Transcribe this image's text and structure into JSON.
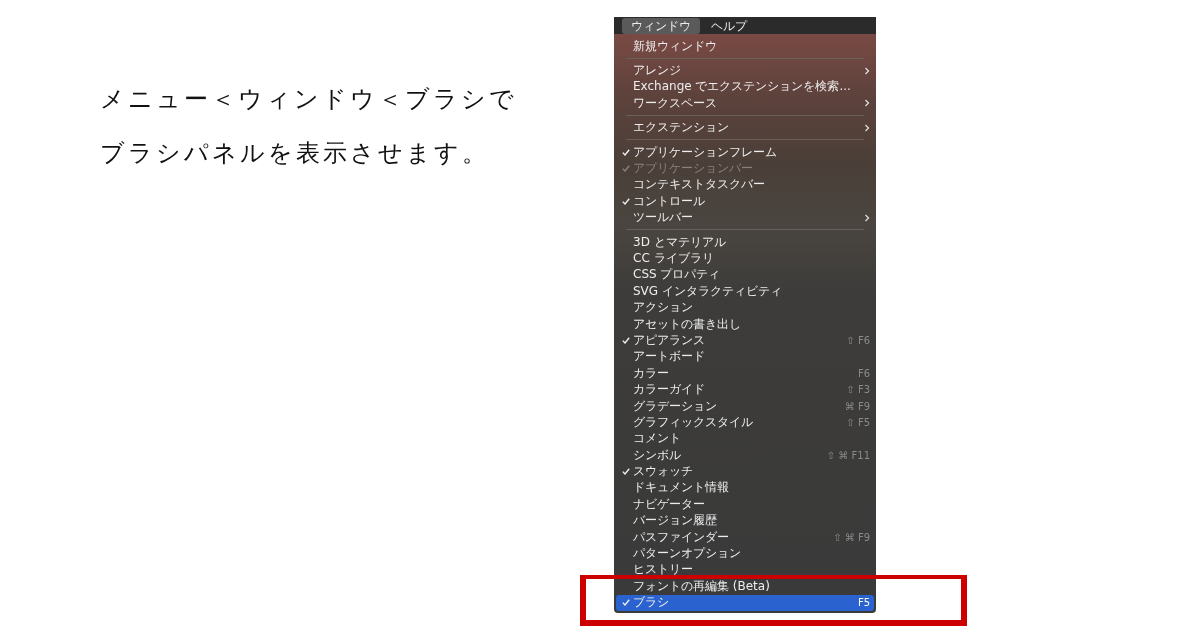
{
  "instruction": {
    "lines": [
      "メニュー＜ウィンドウ＜ブラシで",
      "ブラシパネルを表示させます。"
    ]
  },
  "menu_bar": [
    {
      "label": "ウィンドウ",
      "selected": true
    },
    {
      "label": "ヘルプ",
      "selected": false
    }
  ],
  "menu": {
    "items": [
      {
        "kind": "item",
        "label": "新規ウィンドウ",
        "checked": false,
        "disabled": false,
        "submenu": false,
        "selected": false
      },
      {
        "kind": "separator"
      },
      {
        "kind": "item",
        "label": "アレンジ",
        "checked": false,
        "disabled": false,
        "submenu": true,
        "selected": false
      },
      {
        "kind": "item",
        "label": "Exchange でエクステンションを検索...",
        "checked": false,
        "disabled": false,
        "submenu": false,
        "selected": false
      },
      {
        "kind": "item",
        "label": "ワークスペース",
        "checked": false,
        "disabled": false,
        "submenu": true,
        "selected": false
      },
      {
        "kind": "separator"
      },
      {
        "kind": "item",
        "label": "エクステンション",
        "checked": false,
        "disabled": false,
        "submenu": true,
        "selected": false
      },
      {
        "kind": "separator"
      },
      {
        "kind": "item",
        "label": "アプリケーションフレーム",
        "checked": true,
        "disabled": false,
        "submenu": false,
        "selected": false
      },
      {
        "kind": "item",
        "label": "アプリケーションバー",
        "checked": true,
        "disabled": true,
        "submenu": false,
        "selected": false
      },
      {
        "kind": "item",
        "label": "コンテキストタスクバー",
        "checked": false,
        "disabled": false,
        "submenu": false,
        "selected": false
      },
      {
        "kind": "item",
        "label": "コントロール",
        "checked": true,
        "disabled": false,
        "submenu": false,
        "selected": false
      },
      {
        "kind": "item",
        "label": "ツールバー",
        "checked": false,
        "disabled": false,
        "submenu": true,
        "selected": false
      },
      {
        "kind": "separator"
      },
      {
        "kind": "item",
        "label": "3D とマテリアル",
        "checked": false,
        "disabled": false,
        "submenu": false,
        "selected": false
      },
      {
        "kind": "item",
        "label": "CC ライブラリ",
        "checked": false,
        "disabled": false,
        "submenu": false,
        "selected": false
      },
      {
        "kind": "item",
        "label": "CSS プロパティ",
        "checked": false,
        "disabled": false,
        "submenu": false,
        "selected": false
      },
      {
        "kind": "item",
        "label": "SVG インタラクティビティ",
        "checked": false,
        "disabled": false,
        "submenu": false,
        "selected": false
      },
      {
        "kind": "item",
        "label": "アクション",
        "checked": false,
        "disabled": false,
        "submenu": false,
        "selected": false
      },
      {
        "kind": "item",
        "label": "アセットの書き出し",
        "checked": false,
        "disabled": false,
        "submenu": false,
        "selected": false
      },
      {
        "kind": "item",
        "label": "アピアランス",
        "shortcut": "⇧ F6",
        "checked": true,
        "disabled": false,
        "submenu": false,
        "selected": false
      },
      {
        "kind": "item",
        "label": "アートボード",
        "checked": false,
        "disabled": false,
        "submenu": false,
        "selected": false
      },
      {
        "kind": "item",
        "label": "カラー",
        "shortcut": "F6",
        "checked": false,
        "disabled": false,
        "submenu": false,
        "selected": false
      },
      {
        "kind": "item",
        "label": "カラーガイド",
        "shortcut": "⇧ F3",
        "checked": false,
        "disabled": false,
        "submenu": false,
        "selected": false
      },
      {
        "kind": "item",
        "label": "グラデーション",
        "shortcut": "⌘ F9",
        "checked": false,
        "disabled": false,
        "submenu": false,
        "selected": false
      },
      {
        "kind": "item",
        "label": "グラフィックスタイル",
        "shortcut": "⇧ F5",
        "checked": false,
        "disabled": false,
        "submenu": false,
        "selected": false
      },
      {
        "kind": "item",
        "label": "コメント",
        "checked": false,
        "disabled": false,
        "submenu": false,
        "selected": false
      },
      {
        "kind": "item",
        "label": "シンボル",
        "shortcut": "⇧ ⌘ F11",
        "checked": false,
        "disabled": false,
        "submenu": false,
        "selected": false
      },
      {
        "kind": "item",
        "label": "スウォッチ",
        "checked": true,
        "disabled": false,
        "submenu": false,
        "selected": false
      },
      {
        "kind": "item",
        "label": "ドキュメント情報",
        "checked": false,
        "disabled": false,
        "submenu": false,
        "selected": false
      },
      {
        "kind": "item",
        "label": "ナビゲーター",
        "checked": false,
        "disabled": false,
        "submenu": false,
        "selected": false
      },
      {
        "kind": "item",
        "label": "バージョン履歴",
        "checked": false,
        "disabled": false,
        "submenu": false,
        "selected": false
      },
      {
        "kind": "item",
        "label": "パスファインダー",
        "shortcut": "⇧ ⌘ F9",
        "checked": false,
        "disabled": false,
        "submenu": false,
        "selected": false
      },
      {
        "kind": "item",
        "label": "パターンオプション",
        "checked": false,
        "disabled": false,
        "submenu": false,
        "selected": false
      },
      {
        "kind": "item",
        "label": "ヒストリー",
        "checked": false,
        "disabled": false,
        "submenu": false,
        "selected": false
      },
      {
        "kind": "item",
        "label": "フォントの再編集 (Beta)",
        "checked": false,
        "disabled": false,
        "submenu": false,
        "selected": false
      },
      {
        "kind": "item",
        "label": "ブラシ",
        "shortcut": "F5",
        "checked": true,
        "disabled": false,
        "submenu": false,
        "selected": true
      }
    ]
  }
}
